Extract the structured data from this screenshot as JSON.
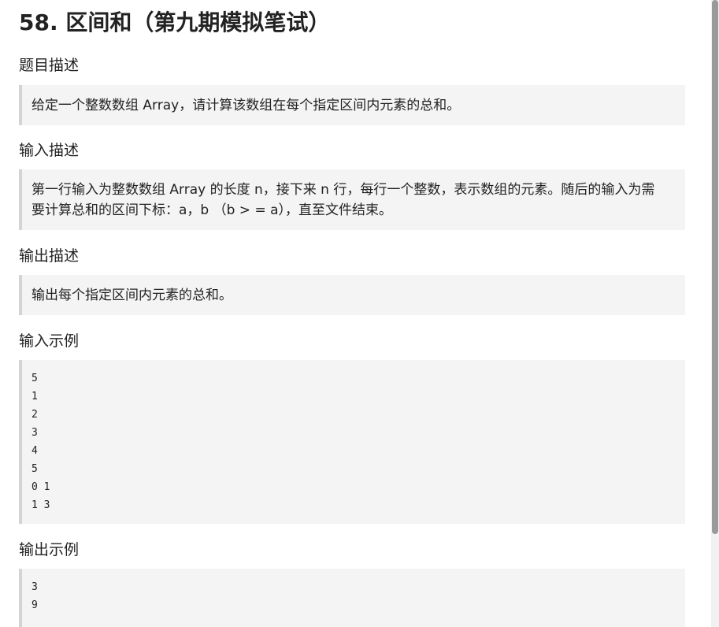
{
  "problem": {
    "title": "58. 区间和（第九期模拟笔试）",
    "sections": {
      "description": {
        "heading": "题目描述",
        "text": "给定一个整数数组 Array，请计算该数组在每个指定区间内元素的总和。"
      },
      "input": {
        "heading": "输入描述",
        "lines": [
          "第一行输入为整数数组 Array 的长度 n，接下来 n 行，每行一个整数，表示数组的元素。随后的输入为需",
          "要计算总和的区间下标：a，b （b > = a），直至文件结束。"
        ]
      },
      "output": {
        "heading": "输出描述",
        "text": "输出每个指定区间内元素的总和。"
      },
      "sample_input": {
        "heading": "输入示例",
        "lines": [
          "5",
          "1",
          "2",
          "3",
          "4",
          "5",
          "0 1",
          "1 3"
        ]
      },
      "sample_output": {
        "heading": "输出示例",
        "lines": [
          "3",
          "9"
        ]
      }
    }
  }
}
